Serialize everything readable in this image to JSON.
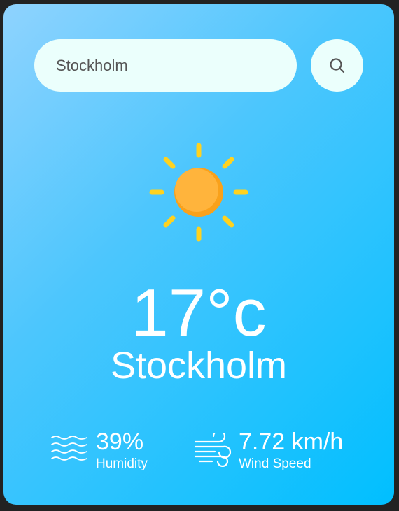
{
  "search": {
    "value": "Stockholm",
    "placeholder": ""
  },
  "weather": {
    "icon": "sun-icon",
    "temperature": "17°c",
    "city": "Stockholm"
  },
  "details": {
    "humidity": {
      "icon": "humidity-waves-icon",
      "value": "39%",
      "label": "Humidity"
    },
    "wind": {
      "icon": "wind-icon",
      "value": "7.72 km/h",
      "label": "Wind Speed"
    }
  },
  "colors": {
    "card_gradient_start": "#8fd3fe",
    "card_gradient_end": "#00bfff",
    "input_background": "#ebfffc",
    "sun_core": "#ffb43c",
    "sun_rays": "#ffd21f",
    "text": "#ffffff"
  }
}
